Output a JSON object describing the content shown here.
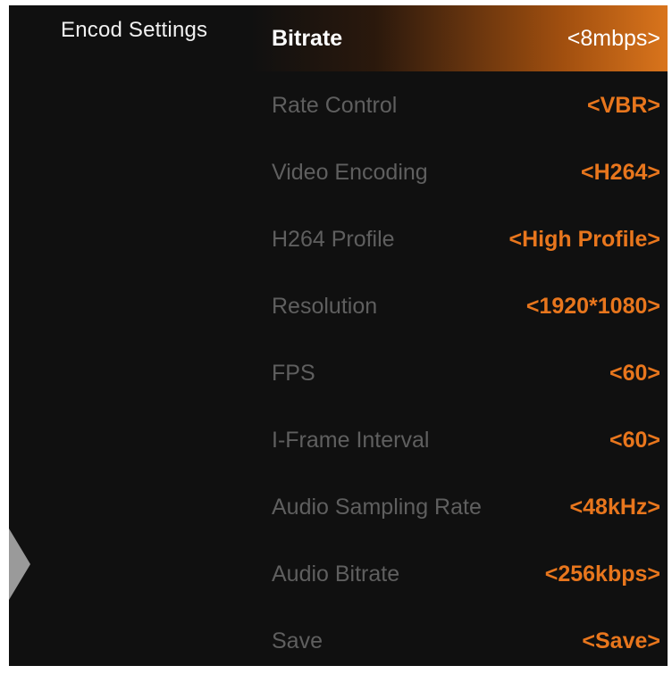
{
  "sidebar": {
    "title": "Encod Settings"
  },
  "menu": {
    "items": [
      {
        "label": "Bitrate",
        "value": "<8mbps>"
      },
      {
        "label": "Rate Control",
        "value": "<VBR>"
      },
      {
        "label": "Video Encoding",
        "value": "<H264>"
      },
      {
        "label": "H264 Profile",
        "value": "<High Profile>"
      },
      {
        "label": "Resolution",
        "value": "<1920*1080>"
      },
      {
        "label": "FPS",
        "value": "<60>"
      },
      {
        "label": "I-Frame Interval",
        "value": "<60>"
      },
      {
        "label": "Audio Sampling Rate",
        "value": "<48kHz>"
      },
      {
        "label": "Audio Bitrate",
        "value": "<256kbps>"
      },
      {
        "label": "Save",
        "value": "<Save>"
      }
    ]
  },
  "colors": {
    "background": "#101010",
    "accent": "#e8761d",
    "label_inactive": "#5f5f5f",
    "label_active": "#ffffff"
  }
}
